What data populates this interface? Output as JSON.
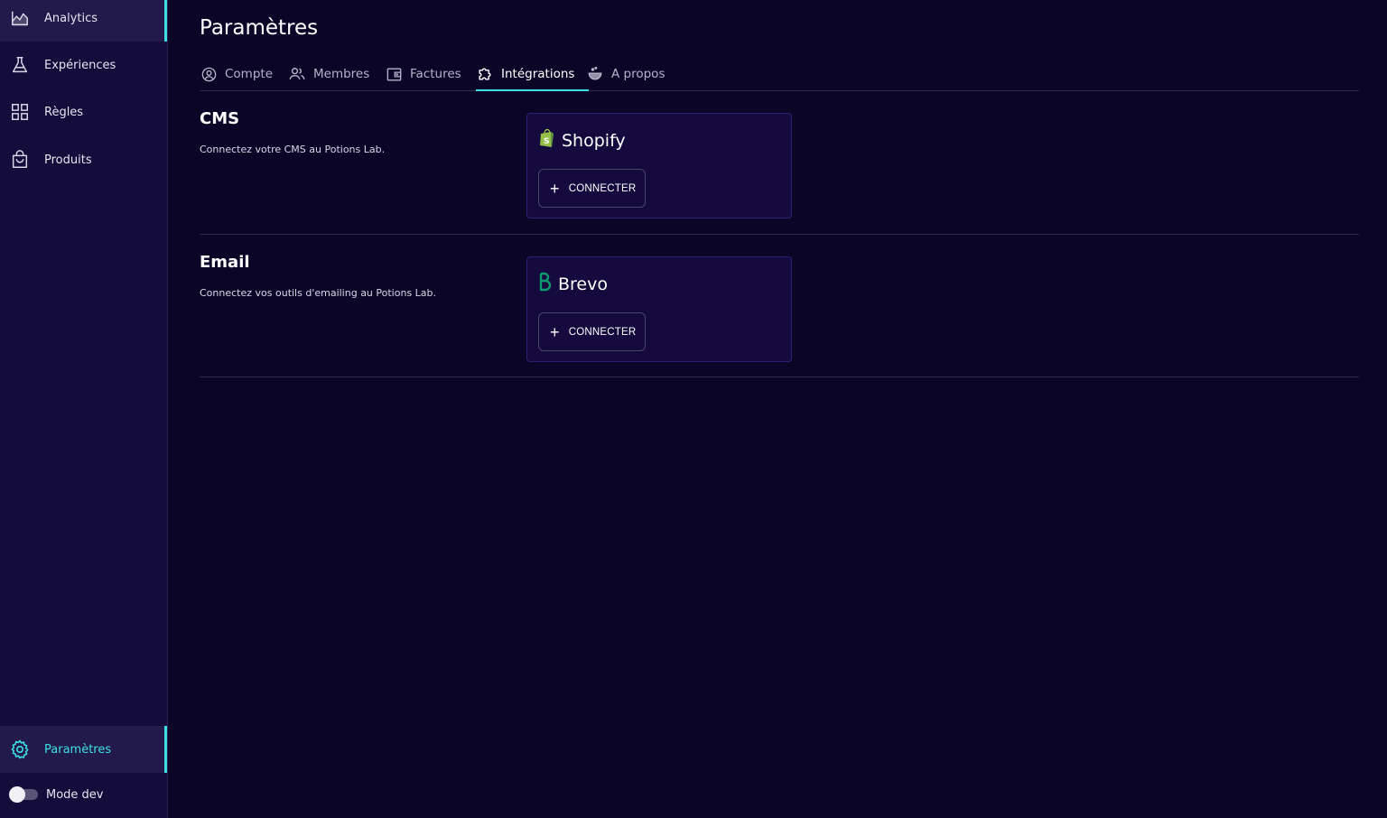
{
  "sidebar": {
    "items": [
      {
        "label": "Analytics",
        "icon": "analytics-chart-icon"
      },
      {
        "label": "Expériences",
        "icon": "flask-icon"
      },
      {
        "label": "Règles",
        "icon": "grid-icon"
      },
      {
        "label": "Produits",
        "icon": "shopping-bag-icon"
      }
    ],
    "settings": {
      "label": "Paramètres",
      "icon": "gear-icon"
    },
    "mode_dev": {
      "label": "Mode dev",
      "enabled": false
    }
  },
  "page": {
    "title": "Paramètres"
  },
  "tabs": [
    {
      "label": "Compte",
      "icon": "user-circle-icon"
    },
    {
      "label": "Membres",
      "icon": "users-icon"
    },
    {
      "label": "Factures",
      "icon": "wallet-icon"
    },
    {
      "label": "Intégrations",
      "icon": "puzzle-icon",
      "active": true
    },
    {
      "label": "A propos",
      "icon": "potion-icon"
    }
  ],
  "sections": [
    {
      "title": "CMS",
      "description": "Connectez votre CMS au Potions Lab.",
      "integration": {
        "name": "Shopify",
        "icon": "shopify-icon",
        "button": "CONNECTER"
      }
    },
    {
      "title": "Email",
      "description": "Connectez vos outils d'emailing au Potions Lab.",
      "integration": {
        "name": "Brevo",
        "icon": "brevo-icon",
        "button": "CONNECTER"
      }
    }
  ],
  "colors": {
    "background": "#0b0628",
    "sidebar": "#140c3a",
    "accent": "#3ee0e6",
    "card": "#140a3e"
  }
}
